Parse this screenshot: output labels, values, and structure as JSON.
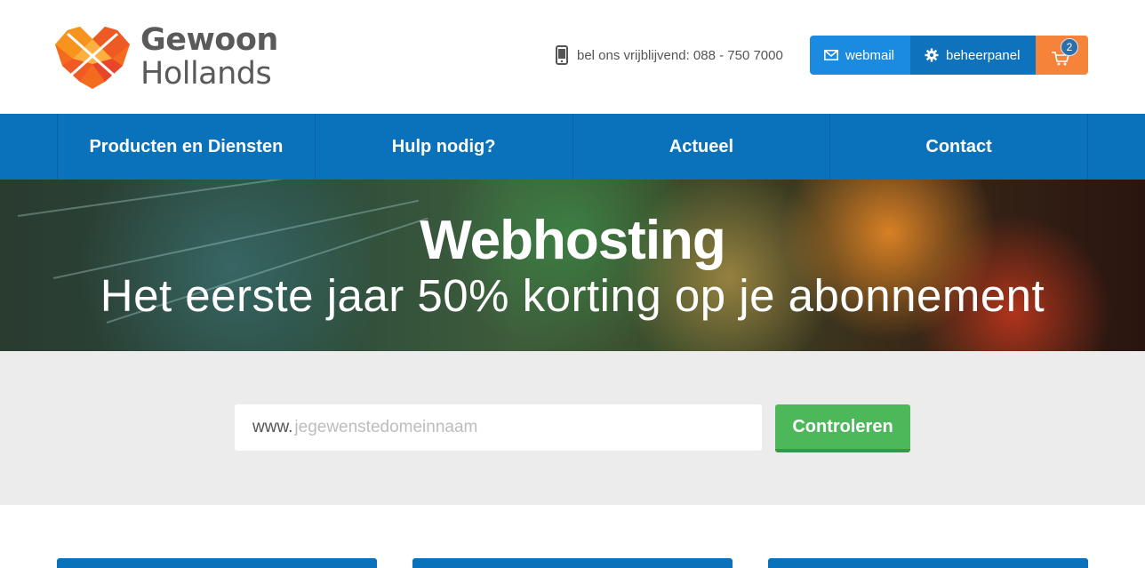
{
  "header": {
    "logo": {
      "line1": "Gewoon",
      "line2": "Hollands"
    },
    "phone": {
      "icon": "mobile-phone-icon",
      "text": "bel ons vrijblijvend: 088 - 750 7000"
    },
    "buttons": {
      "webmail": {
        "label": "webmail",
        "icon": "envelope-icon"
      },
      "beheerpanel": {
        "label": "beheerpanel",
        "icon": "gear-icon"
      },
      "cart": {
        "icon": "cart-icon",
        "count": "2"
      }
    },
    "colors": {
      "webmail": "#1a8be0",
      "beheerpanel": "#0f72bd",
      "cart": "#f5843a"
    }
  },
  "nav": {
    "items": [
      {
        "label": "Producten en Diensten"
      },
      {
        "label": "Hulp nodig?"
      },
      {
        "label": "Actueel"
      },
      {
        "label": "Contact"
      }
    ],
    "color": "#0a72bb"
  },
  "hero": {
    "title": "Webhosting",
    "subtitle": "Het eerste jaar 50% korting op je abonnement"
  },
  "domain_search": {
    "prefix": "www.",
    "placeholder": "jegewenstedomeinnaam",
    "value": "",
    "button_label": "Controleren",
    "button_color": "#4cb85a"
  }
}
